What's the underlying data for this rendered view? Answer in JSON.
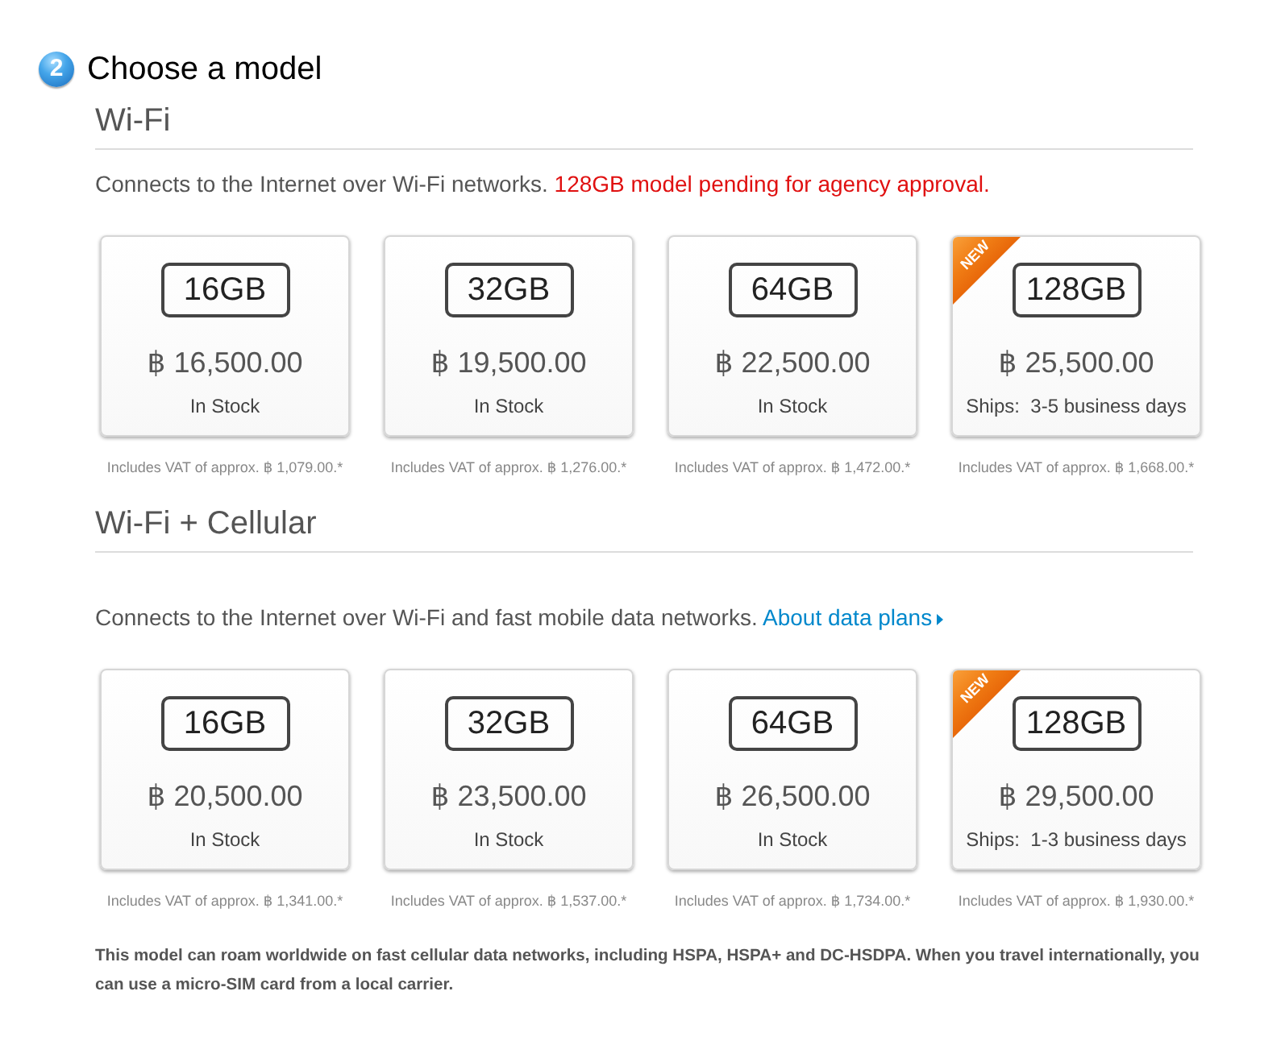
{
  "step": {
    "number": "2",
    "title": "Choose a model"
  },
  "sections": [
    {
      "title": "Wi-Fi",
      "description": [
        {
          "kind": "text",
          "text": "Connects to the Internet over Wi-Fi networks."
        },
        {
          "kind": "alert",
          "text": "128GB model pending for agency approval."
        }
      ],
      "models": [
        {
          "capacity": "16GB",
          "price": "฿ 16,500.00",
          "availability": "In Stock",
          "vat_note": "Includes VAT of approx. ฿ 1,079.00.*",
          "selected": false
        },
        {
          "capacity": "32GB",
          "price": "฿ 19,500.00",
          "availability": "In Stock",
          "vat_note": "Includes VAT of approx. ฿ 1,276.00.*",
          "selected": false
        },
        {
          "capacity": "64GB",
          "price": "฿ 22,500.00",
          "availability": "In Stock",
          "vat_note": "Includes VAT of approx. ฿ 1,472.00.*",
          "selected": false
        },
        {
          "capacity": "128GB",
          "ribbon": "NEW",
          "price": "฿ 25,500.00",
          "availability": "Ships:  3-5 business days",
          "vat_note": "Includes VAT of approx. ฿ 1,668.00.*",
          "selected": false
        }
      ]
    },
    {
      "title": "Wi-Fi + Cellular",
      "description": [
        {
          "kind": "text",
          "text": "Connects to the Internet over Wi-Fi and fast mobile data networks."
        },
        {
          "kind": "link",
          "text": "About data plans"
        }
      ],
      "models": [
        {
          "capacity": "16GB",
          "price": "฿ 20,500.00",
          "availability": "In Stock",
          "vat_note": "Includes VAT of approx. ฿ 1,341.00.*",
          "selected": false
        },
        {
          "capacity": "32GB",
          "price": "฿ 23,500.00",
          "availability": "In Stock",
          "vat_note": "Includes VAT of approx. ฿ 1,537.00.*",
          "selected": false
        },
        {
          "capacity": "64GB",
          "price": "฿ 26,500.00",
          "availability": "In Stock",
          "vat_note": "Includes VAT of approx. ฿ 1,734.00.*",
          "selected": false
        },
        {
          "capacity": "128GB",
          "ribbon": "NEW",
          "price": "฿ 29,500.00",
          "availability": "Ships:  1-3 business days",
          "vat_note": "Includes VAT of approx. ฿ 1,930.00.*",
          "selected": false
        }
      ]
    }
  ],
  "footnote": "This model can roam worldwide on fast cellular data networks, including HSPA, HSPA+ and DC-HSDPA. When you travel internationally, you can use a micro-SIM card from a local carrier."
}
